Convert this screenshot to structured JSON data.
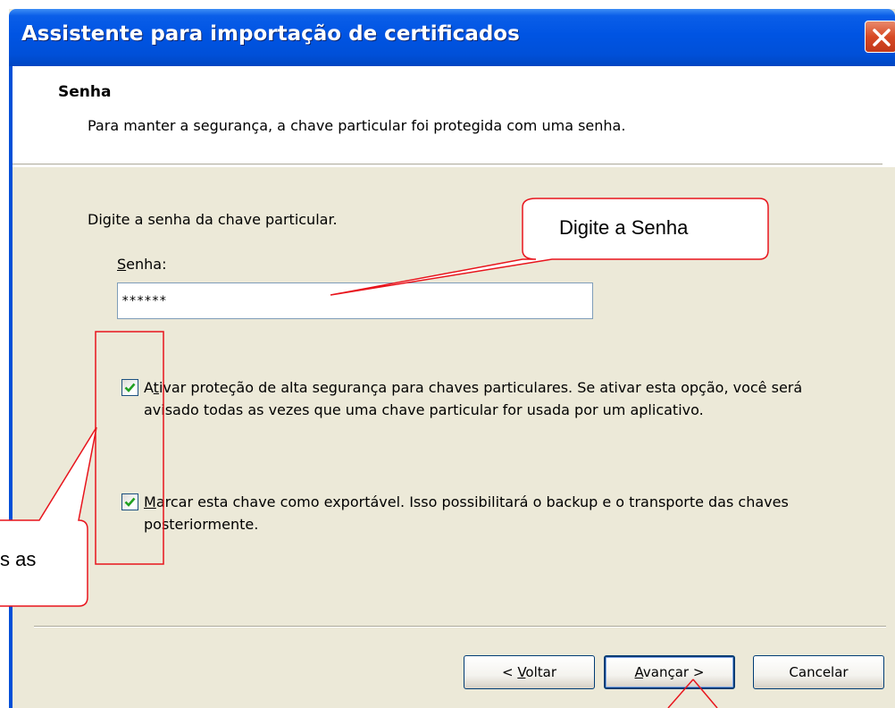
{
  "window": {
    "title": "Assistente para importação de certificados"
  },
  "header": {
    "title": "Senha",
    "description": "Para manter a segurança, a chave particular foi protegida com uma senha."
  },
  "body": {
    "prompt": "Digite a senha da chave particular.",
    "password_label_mnemonic": "S",
    "password_label_rest": "enha:",
    "password_value": "******",
    "checkbox_high_security": {
      "checked": true,
      "mnemonic_prefix": "A",
      "mnemonic": "t",
      "text_rest": "ivar proteção de alta segurança para chaves particulares. Se ativar esta opção, você será avisado todas as vezes que uma chave particular for usada por um aplicativo."
    },
    "checkbox_exportable": {
      "checked": true,
      "mnemonic": "M",
      "text_rest": "arcar esta chave como exportável. Isso possibilitará o backup e o transporte das chaves posteriormente."
    }
  },
  "buttons": {
    "back_prefix": "< ",
    "back_mnemonic": "V",
    "back_rest": "oltar",
    "next_mnemonic": "A",
    "next_rest": "vançar >",
    "cancel": "Cancelar"
  },
  "annotations": {
    "password_callout": "Digite a Senha",
    "checkbox_callout": "s as",
    "annotation_color": "#e8141c"
  },
  "colors": {
    "titlebar": "#0054e3",
    "dialog_bg": "#ece9d8",
    "checkmark": "#21a121",
    "close_button": "#d74a25"
  }
}
